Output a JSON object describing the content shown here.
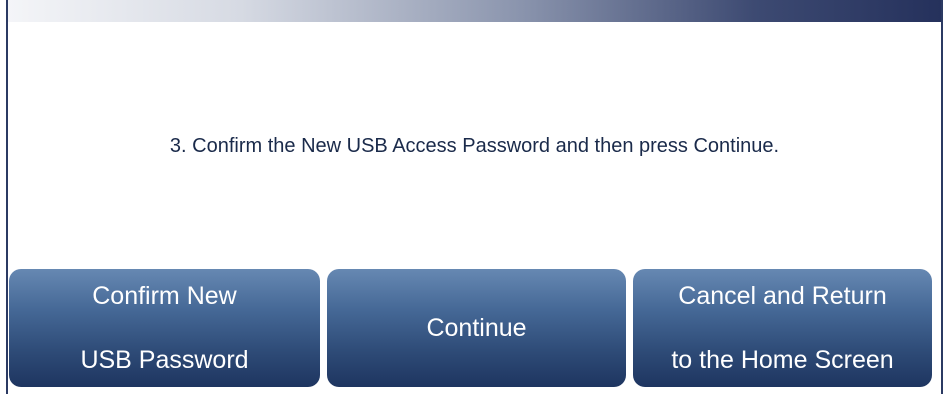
{
  "message": "3. Confirm the New USB Access Password and then press Continue.",
  "buttons": {
    "confirm": {
      "line1": "Confirm New",
      "line2": "USB Password"
    },
    "continue": {
      "label": "Continue"
    },
    "cancel": {
      "line1": "Cancel and Return",
      "line2": "to the Home Screen"
    }
  },
  "colors": {
    "button_top": "#6688b2",
    "button_bottom": "#1e3560",
    "frame": "#2b3a63",
    "text": "#1a2a4a"
  }
}
